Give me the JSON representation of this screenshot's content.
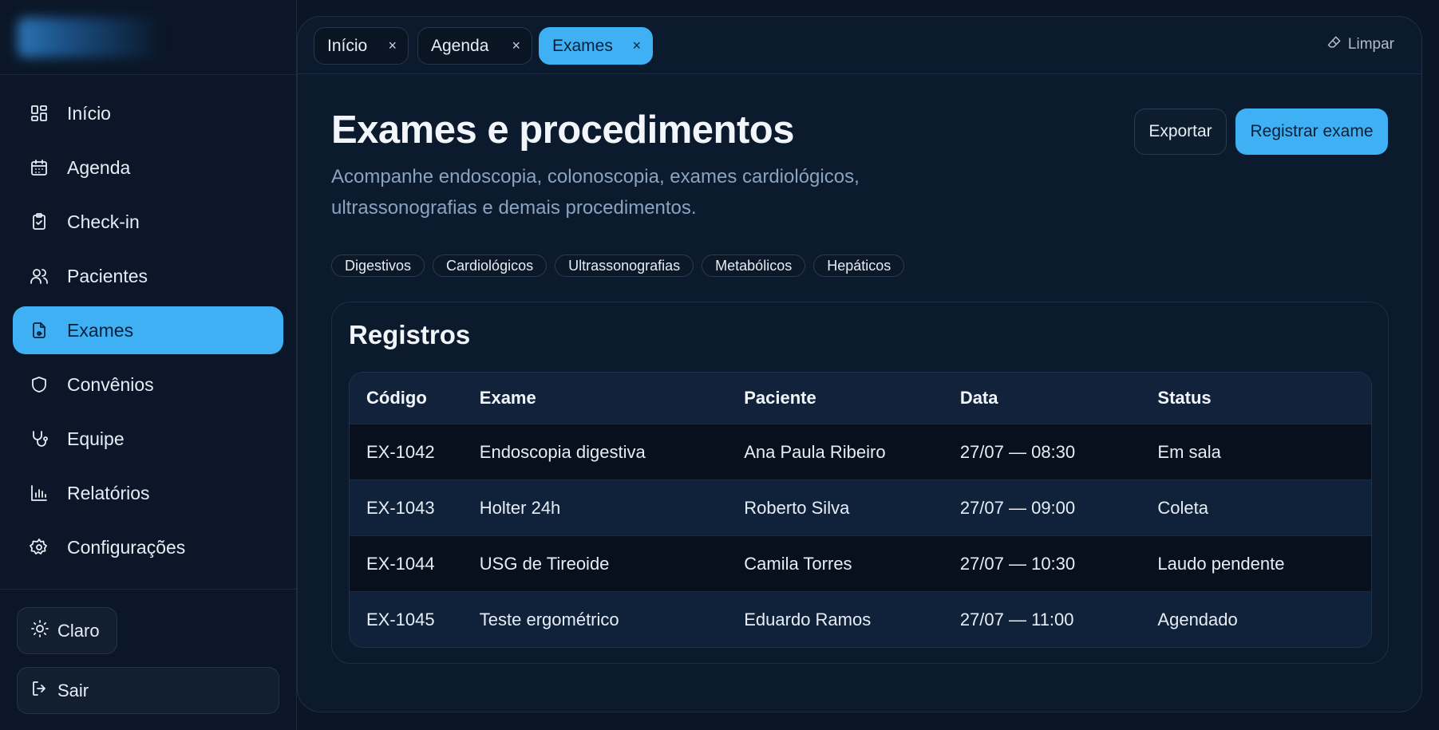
{
  "colors": {
    "accent": "#3fb0f4",
    "background": "#0a1626",
    "panel": "#0c1a2d",
    "muted_text": "#8aa3bf"
  },
  "sidebar": {
    "items": [
      {
        "label": "Início",
        "icon": "dashboard-icon",
        "active": false
      },
      {
        "label": "Agenda",
        "icon": "calendar-icon",
        "active": false
      },
      {
        "label": "Check-in",
        "icon": "clipboard-check-icon",
        "active": false
      },
      {
        "label": "Pacientes",
        "icon": "users-icon",
        "active": false
      },
      {
        "label": "Exames",
        "icon": "file-medical-icon",
        "active": true
      },
      {
        "label": "Convênios",
        "icon": "shield-icon",
        "active": false
      },
      {
        "label": "Equipe",
        "icon": "stethoscope-icon",
        "active": false
      },
      {
        "label": "Relatórios",
        "icon": "bar-chart-icon",
        "active": false
      },
      {
        "label": "Configurações",
        "icon": "gear-icon",
        "active": false
      }
    ],
    "theme_label": "Claro",
    "logout_label": "Sair"
  },
  "tabs": [
    {
      "label": "Início",
      "close": "×",
      "active": false
    },
    {
      "label": "Agenda",
      "close": "×",
      "active": false
    },
    {
      "label": "Exames",
      "close": "×",
      "active": true
    }
  ],
  "tabbar": {
    "clear_label": "Limpar"
  },
  "header": {
    "title": "Exames e procedimentos",
    "subtitle": "Acompanhe endoscopia, colonoscopia, exames cardiológicos, ultrassonografias e demais procedimentos.",
    "export_label": "Exportar",
    "register_label": "Registrar exame"
  },
  "chips": [
    "Digestivos",
    "Cardiológicos",
    "Ultrassonografias",
    "Metabólicos",
    "Hepáticos"
  ],
  "records": {
    "title": "Registros",
    "columns": [
      "Código",
      "Exame",
      "Paciente",
      "Data",
      "Status"
    ],
    "rows": [
      [
        "EX-1042",
        "Endoscopia digestiva",
        "Ana Paula Ribeiro",
        "27/07 — 08:30",
        "Em sala"
      ],
      [
        "EX-1043",
        "Holter 24h",
        "Roberto Silva",
        "27/07 — 09:00",
        "Coleta"
      ],
      [
        "EX-1044",
        "USG de Tireoide",
        "Camila Torres",
        "27/07 — 10:30",
        "Laudo pendente"
      ],
      [
        "EX-1045",
        "Teste ergométrico",
        "Eduardo Ramos",
        "27/07 — 11:00",
        "Agendado"
      ]
    ]
  }
}
